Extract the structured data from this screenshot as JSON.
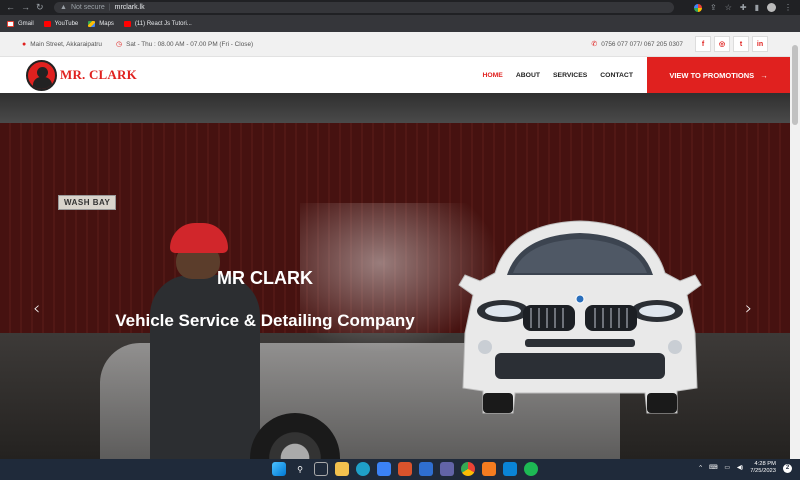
{
  "browser": {
    "security": "Not secure",
    "url": "mrclark.lk",
    "bookmarks": [
      "Gmail",
      "YouTube",
      "Maps",
      "(11) React Js Tutori..."
    ]
  },
  "topbar": {
    "address": "Main Street, Akkaraipatru",
    "hours": "Sat - Thu : 08.00 AM - 07.00 PM (Fri - Close)",
    "phone": "0756 077 077/ 067 205 0307",
    "social": [
      "f",
      "ig",
      "tw",
      "in"
    ]
  },
  "header": {
    "logo_text": "MR. CLARK",
    "nav": [
      "HOME",
      "ABOUT",
      "SERVICES",
      "CONTACT"
    ],
    "active_nav": "HOME",
    "promo_button": "VIEW TO PROMOTIONS"
  },
  "hero": {
    "sign": "WASH BAY",
    "title": "MR CLARK",
    "subtitle": "Vehicle Service & Detailing Company"
  },
  "taskbar": {
    "time": "4:28 PM",
    "date": "7/25/2023",
    "notifications": "2"
  },
  "colors": {
    "accent": "#e0211f",
    "taskbar": "#1f2a3a"
  }
}
